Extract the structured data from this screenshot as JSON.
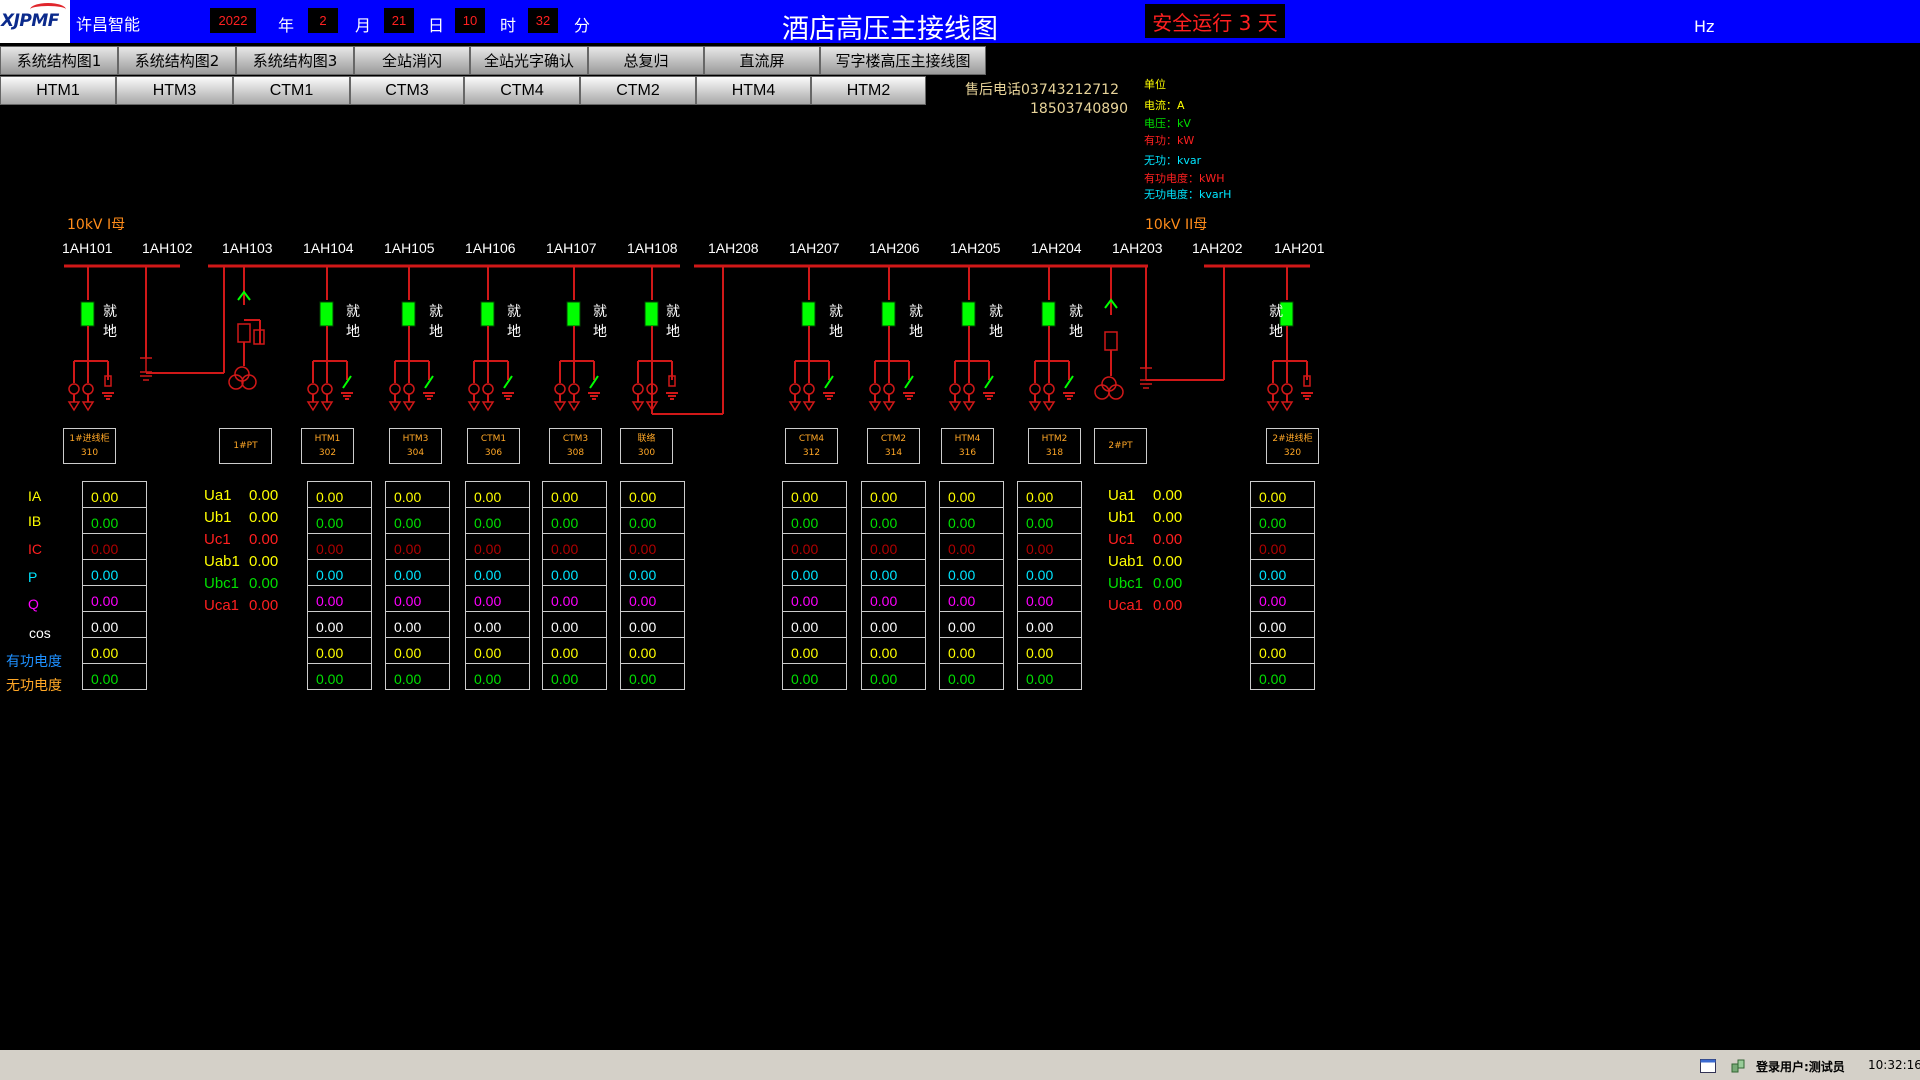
{
  "header": {
    "logo": "XJPMF",
    "company": "许昌智能",
    "date": {
      "year": "2022",
      "year_unit": "年",
      "month": "2",
      "month_unit": "月",
      "day": "21",
      "day_unit": "日",
      "hour": "10",
      "hour_unit": "时",
      "minute": "32",
      "minute_unit": "分"
    },
    "title": "酒店高压主接线图",
    "safe_run": "安全运行 3 天",
    "hz": "Hz"
  },
  "nav_row1": [
    "系统结构图1",
    "系统结构图2",
    "系统结构图3",
    "全站消闪",
    "全站光字确认",
    "总复归",
    "直流屏",
    "写字楼高压主接线图"
  ],
  "nav_row2": [
    "HTM1",
    "HTM3",
    "CTM1",
    "CTM3",
    "CTM4",
    "CTM2",
    "HTM4",
    "HTM2"
  ],
  "contact": {
    "label": "售后电话03743212712",
    "phone2": "18503740890"
  },
  "units": {
    "title": "单位",
    "items": [
      {
        "text": "电流：A",
        "color": "#ffff00"
      },
      {
        "text": "电压：kV",
        "color": "#00e000"
      },
      {
        "text": "有功：kW",
        "color": "#ff2020"
      },
      {
        "text": "无功：kvar",
        "color": "#00e5ff"
      },
      {
        "text": "有功电度：kWH",
        "color": "#ff2020"
      },
      {
        "text": "无功电度：kvarH",
        "color": "#00e5ff"
      }
    ]
  },
  "diagram": {
    "bus1_label": "10kV I母",
    "bus2_label": "10kV II母",
    "bay_names": [
      "1AH101",
      "1AH102",
      "1AH103",
      "1AH104",
      "1AH105",
      "1AH106",
      "1AH107",
      "1AH108",
      "1AH208",
      "1AH207",
      "1AH206",
      "1AH205",
      "1AH204",
      "1AH203",
      "1AH202",
      "1AH201"
    ],
    "local_text": "就地",
    "labels": [
      {
        "line1": "1#进线柜",
        "line2": "310"
      },
      {
        "line1": "1#PT",
        "line2": ""
      },
      {
        "line1": "HTM1",
        "line2": "302"
      },
      {
        "line1": "HTM3",
        "line2": "304"
      },
      {
        "line1": "CTM1",
        "line2": "306"
      },
      {
        "line1": "CTM3",
        "line2": "308"
      },
      {
        "line1": "联络",
        "line2": "300"
      },
      {
        "line1": "CTM4",
        "line2": "312"
      },
      {
        "line1": "CTM2",
        "line2": "314"
      },
      {
        "line1": "HTM4",
        "line2": "316"
      },
      {
        "line1": "HTM2",
        "line2": "318"
      },
      {
        "line1": "2#PT",
        "line2": ""
      },
      {
        "line1": "2#进线柜",
        "line2": "320"
      }
    ]
  },
  "metrics": {
    "row_labels": [
      {
        "text": "IA",
        "color": "#ffff00"
      },
      {
        "text": "IB",
        "color": "#ffff00"
      },
      {
        "text": "IC",
        "color": "#ff2020"
      },
      {
        "text": "P",
        "color": "#00e5ff"
      },
      {
        "text": "Q",
        "color": "#ff00ff"
      },
      {
        "text": "cos",
        "color": "#ffffff"
      },
      {
        "text": "有功电度",
        "color": "#1e90ff"
      },
      {
        "text": "无功电度",
        "color": "#ffa726"
      }
    ],
    "row_colors": [
      "#ffff00",
      "#00e000",
      "#b00000",
      "#00e5ff",
      "#ff00ff",
      "#ffffff",
      "#ffff00",
      "#00e000"
    ],
    "columns": [
      [
        "0.00",
        "0.00",
        "0.00",
        "0.00",
        "0.00",
        "0.00",
        "0.00",
        "0.00"
      ],
      [
        "0.00",
        "0.00",
        "0.00",
        "0.00",
        "0.00",
        "0.00",
        "0.00",
        "0.00"
      ],
      [
        "0.00",
        "0.00",
        "0.00",
        "0.00",
        "0.00",
        "0.00",
        "0.00",
        "0.00"
      ],
      [
        "0.00",
        "0.00",
        "0.00",
        "0.00",
        "0.00",
        "0.00",
        "0.00",
        "0.00"
      ],
      [
        "0.00",
        "0.00",
        "0.00",
        "0.00",
        "0.00",
        "0.00",
        "0.00",
        "0.00"
      ],
      [
        "0.00",
        "0.00",
        "0.00",
        "0.00",
        "0.00",
        "0.00",
        "0.00",
        "0.00"
      ],
      [
        "0.00",
        "0.00",
        "0.00",
        "0.00",
        "0.00",
        "0.00",
        "0.00",
        "0.00"
      ],
      [
        "0.00",
        "0.00",
        "0.00",
        "0.00",
        "0.00",
        "0.00",
        "0.00",
        "0.00"
      ],
      [
        "0.00",
        "0.00",
        "0.00",
        "0.00",
        "0.00",
        "0.00",
        "0.00",
        "0.00"
      ],
      [
        "0.00",
        "0.00",
        "0.00",
        "0.00",
        "0.00",
        "0.00",
        "0.00",
        "0.00"
      ],
      [
        "0.00",
        "0.00",
        "0.00",
        "0.00",
        "0.00",
        "0.00",
        "0.00",
        "0.00"
      ]
    ],
    "pt_blocks": [
      [
        {
          "label": "Ua1",
          "value": "0.00",
          "color": "#ffff00"
        },
        {
          "label": "Ub1",
          "value": "0.00",
          "color": "#ffff00"
        },
        {
          "label": "Uc1",
          "value": "0.00",
          "color": "#ff2020"
        },
        {
          "label": "Uab1",
          "value": "0.00",
          "color": "#ffff00"
        },
        {
          "label": "Ubc1",
          "value": "0.00",
          "color": "#00e000"
        },
        {
          "label": "Uca1",
          "value": "0.00",
          "color": "#ff2020"
        }
      ],
      [
        {
          "label": "Ua1",
          "value": "0.00",
          "color": "#ffff00"
        },
        {
          "label": "Ub1",
          "value": "0.00",
          "color": "#ffff00"
        },
        {
          "label": "Uc1",
          "value": "0.00",
          "color": "#ff2020"
        },
        {
          "label": "Uab1",
          "value": "0.00",
          "color": "#ffff00"
        },
        {
          "label": "Ubc1",
          "value": "0.00",
          "color": "#00e000"
        },
        {
          "label": "Uca1",
          "value": "0.00",
          "color": "#ff2020"
        }
      ]
    ]
  },
  "footer": {
    "user": "登录用户:测试员",
    "time": "10:32:16"
  }
}
